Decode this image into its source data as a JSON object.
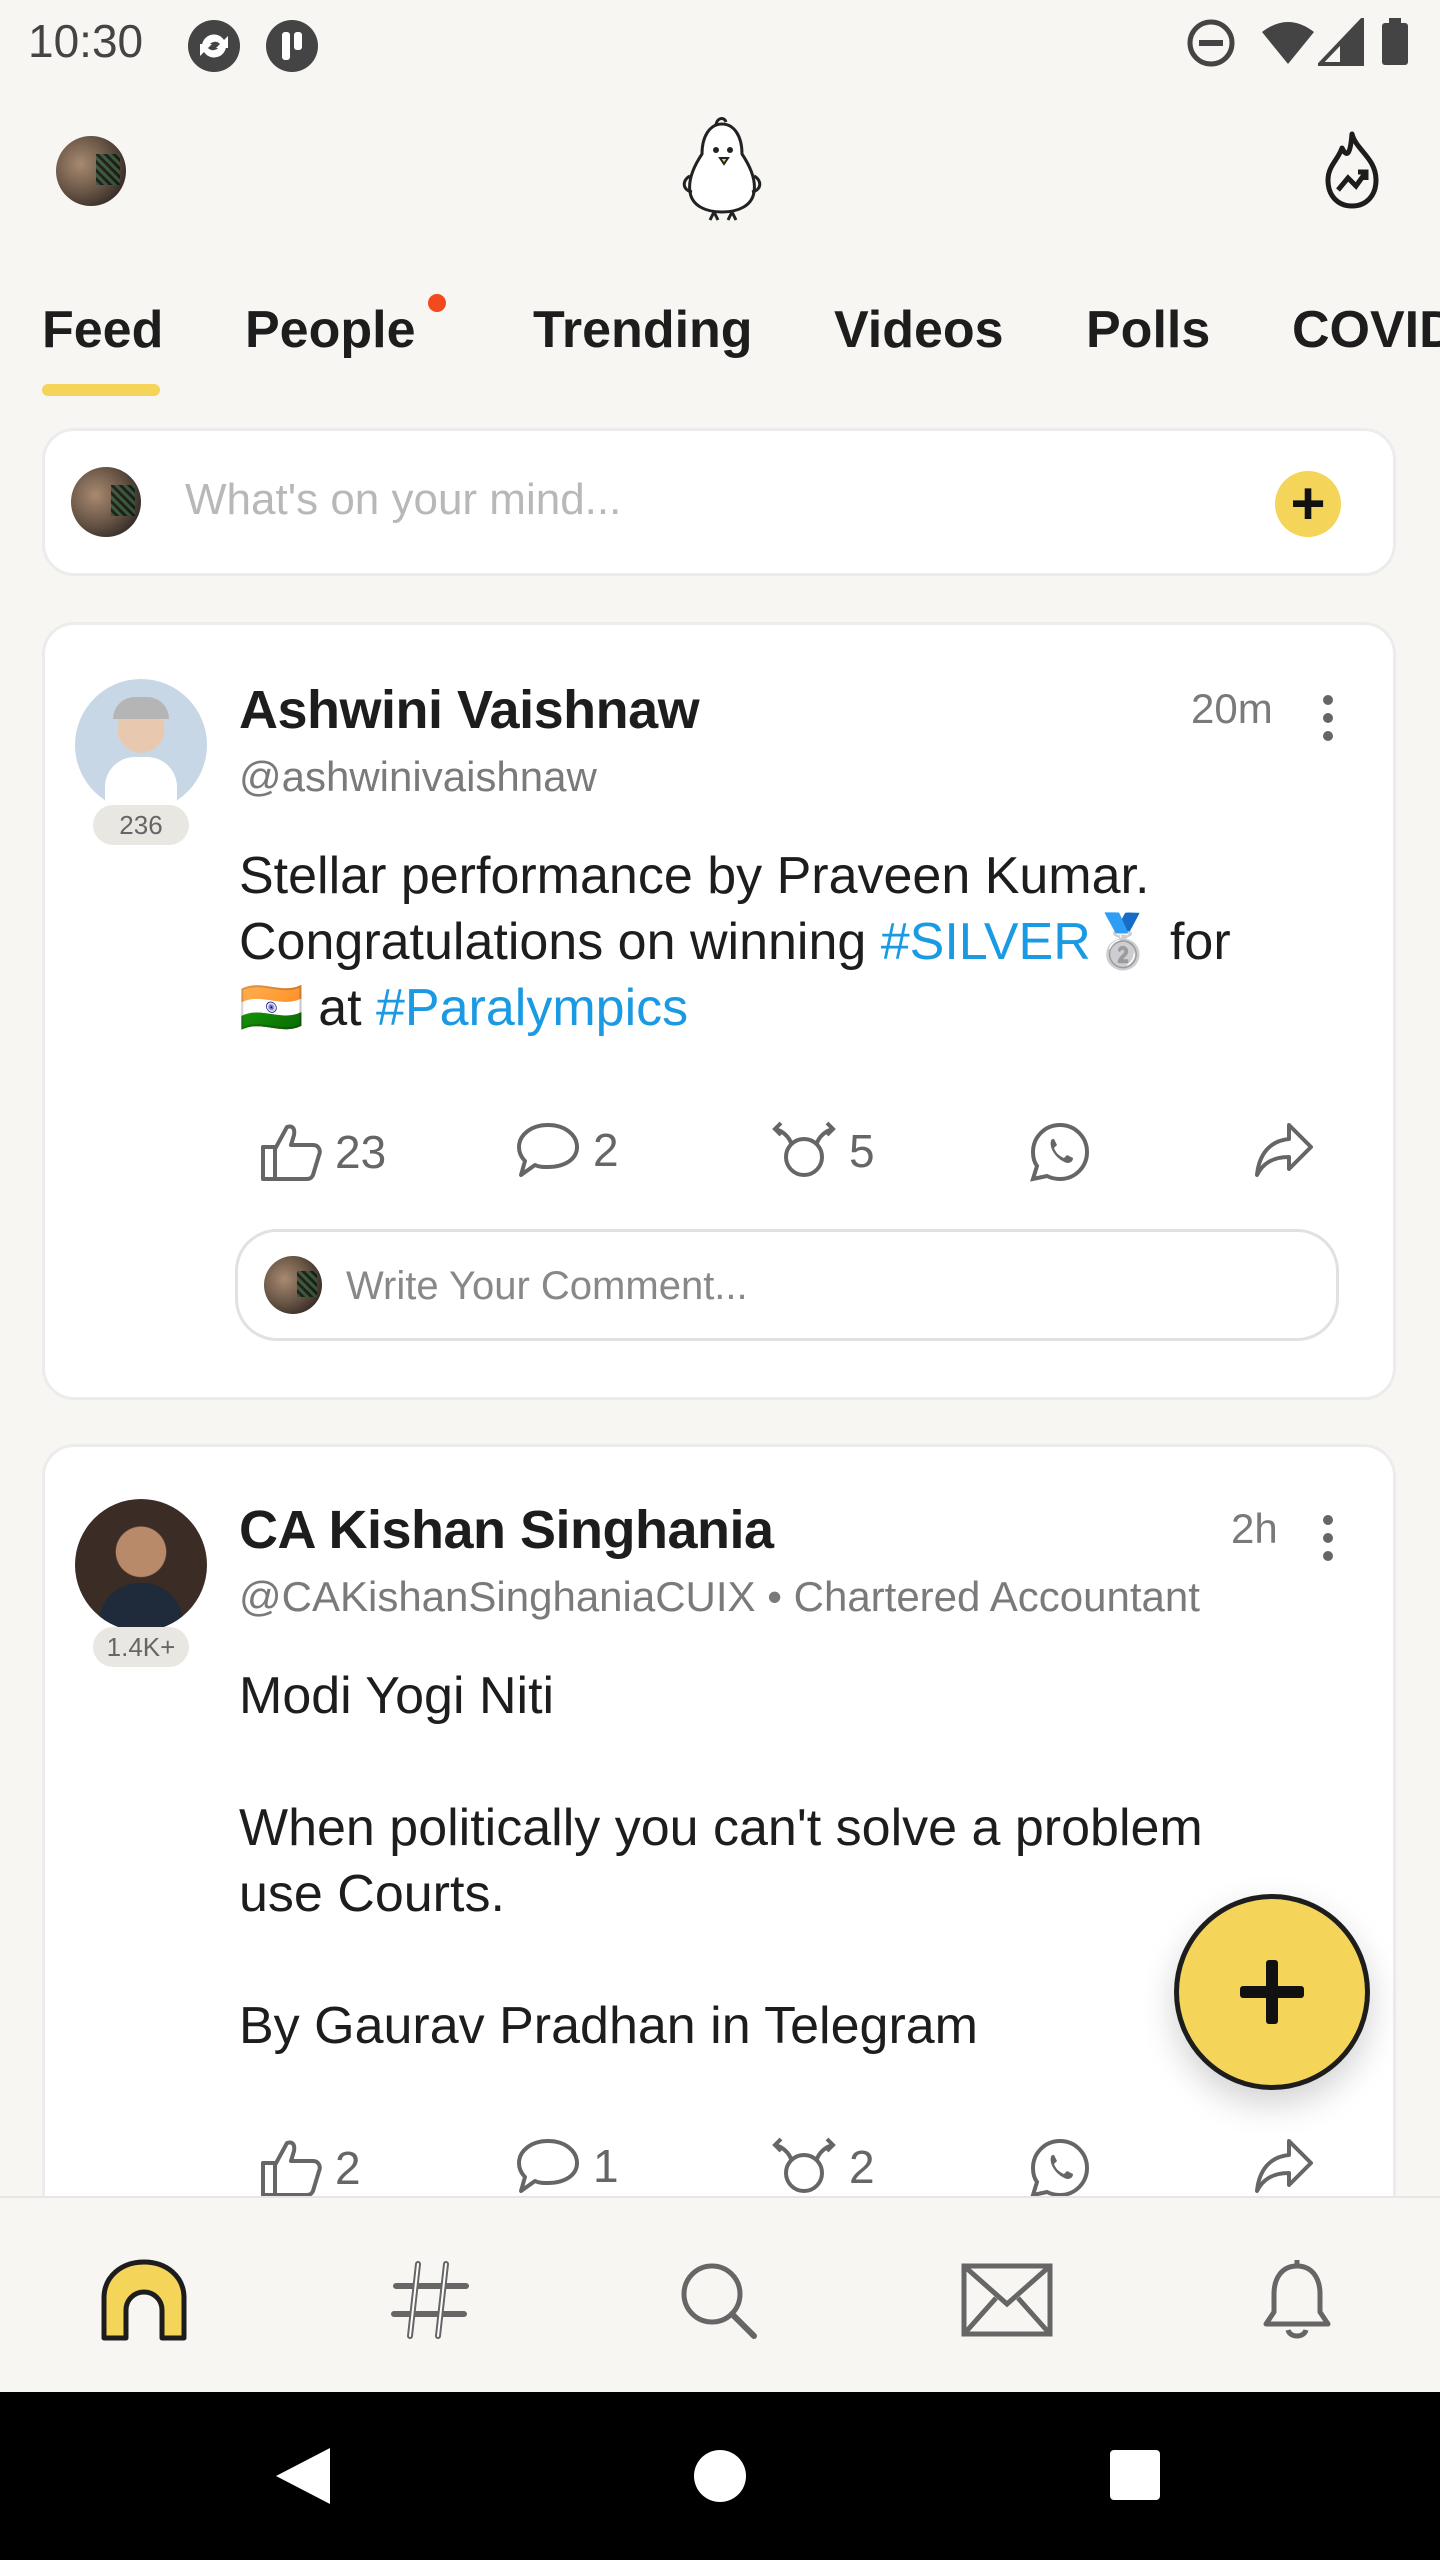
{
  "status_bar": {
    "time": "10:30",
    "icons": [
      "sync-icon",
      "app-icon",
      "dnd-icon",
      "wifi-icon",
      "signal-icon",
      "battery-icon"
    ]
  },
  "header": {
    "logo_icon": "koo-bird-icon",
    "right_icon": "trending-fire-icon"
  },
  "tabs": [
    {
      "label": "Feed",
      "active": true
    },
    {
      "label": "People",
      "badge_dot": true
    },
    {
      "label": "Trending"
    },
    {
      "label": "Videos"
    },
    {
      "label": "Polls"
    },
    {
      "label": "COVID"
    }
  ],
  "composer": {
    "placeholder": "What's on your mind..."
  },
  "posts": [
    {
      "name": "Ashwini Vaishnaw",
      "handle": "@ashwinivaishnaw",
      "time": "20m",
      "followers_badge": "236",
      "text_line1": "Stellar performance by Praveen Kumar.",
      "text_line2_pre": "Congratulations on winning ",
      "text_line2_tag": "#SILVER",
      "text_line2_post": "🥈 for",
      "text_line3_pre": "🇮🇳 at ",
      "text_line3_tag": "#Paralympics",
      "likes": "23",
      "comments": "2",
      "rekoos": "5",
      "comment_placeholder": "Write Your Comment..."
    },
    {
      "name": "CA Kishan Singhania",
      "handle": "@CAKishanSinghaniaCUIX",
      "subtitle": "• Chartered Accountant",
      "time": "2h",
      "followers_badge": "1.4K+",
      "text_line1": "Modi Yogi Niti",
      "text_line2": "When politically you can't solve a problem",
      "text_line3": "use Courts.",
      "text_line4": "By Gaurav Pradhan in Telegram",
      "likes": "2",
      "comments": "1",
      "rekoos": "2"
    }
  ],
  "bottom_nav": [
    "home-icon",
    "hashtag-icon",
    "search-icon",
    "mail-icon",
    "bell-icon"
  ],
  "colors": {
    "accent_yellow": "#f5d45a",
    "hashtag_blue": "#1b9ae4",
    "notification_dot": "#f24a1d",
    "background": "#f7f6f3"
  }
}
